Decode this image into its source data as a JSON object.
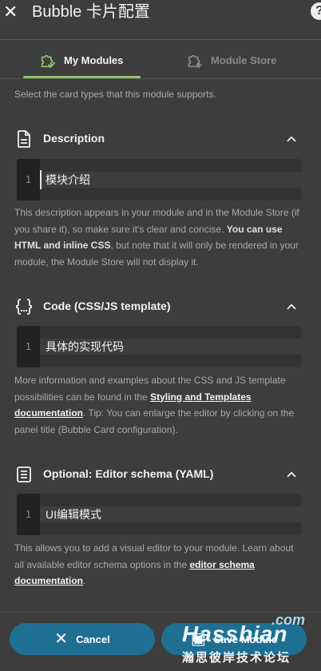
{
  "header": {
    "title": "Bubble 卡片配置",
    "close_icon": "close-icon",
    "help_label": "?"
  },
  "tabs": [
    {
      "label": "My Modules",
      "icon": "puzzle-check-icon",
      "active": true
    },
    {
      "label": "Module Store",
      "icon": "puzzle-plus-icon",
      "active": false
    }
  ],
  "intro": "Select the card types that this module supports.",
  "sections": {
    "description": {
      "title": "Description",
      "icon": "document-icon",
      "line_number": "1",
      "code": "模块介绍",
      "help_1": "This description appears in your module and in the Module Store (if you share it), so make sure it's clear and concise. ",
      "help_bold": "You can use HTML and inline CSS",
      "help_2": ", but note that it will only be rendered in your module, the Module Store will not display it."
    },
    "code": {
      "title": "Code (CSS/JS template)",
      "icon": "code-braces-icon",
      "line_number": "1",
      "code": "具体的实现代码",
      "help_1": "More information and examples about the CSS and JS template possibilities can be found in the ",
      "help_link": "Styling and Templates documentation",
      "help_2": ". Tip: You can enlarge the editor by clicking on the panel title (Bubble Card configuration)."
    },
    "schema": {
      "title": "Optional: Editor schema (YAML)",
      "icon": "list-box-icon",
      "line_number": "1",
      "code": "UI编辑模式",
      "help_1": "This allows you to add a visual editor to your module. Learn about all available editor schema options in the ",
      "help_link": "editor schema documentation",
      "help_2": "."
    }
  },
  "footer": {
    "cancel_label": "Cancel",
    "save_label": "Save Module"
  },
  "watermark": {
    "com": ".com",
    "name": "Hassbian",
    "cn": "瀚思彼岸技术论坛"
  },
  "colors": {
    "background": "#3d3d3d",
    "accent_green": "#93c66b",
    "button_blue": "#1f6f93"
  }
}
